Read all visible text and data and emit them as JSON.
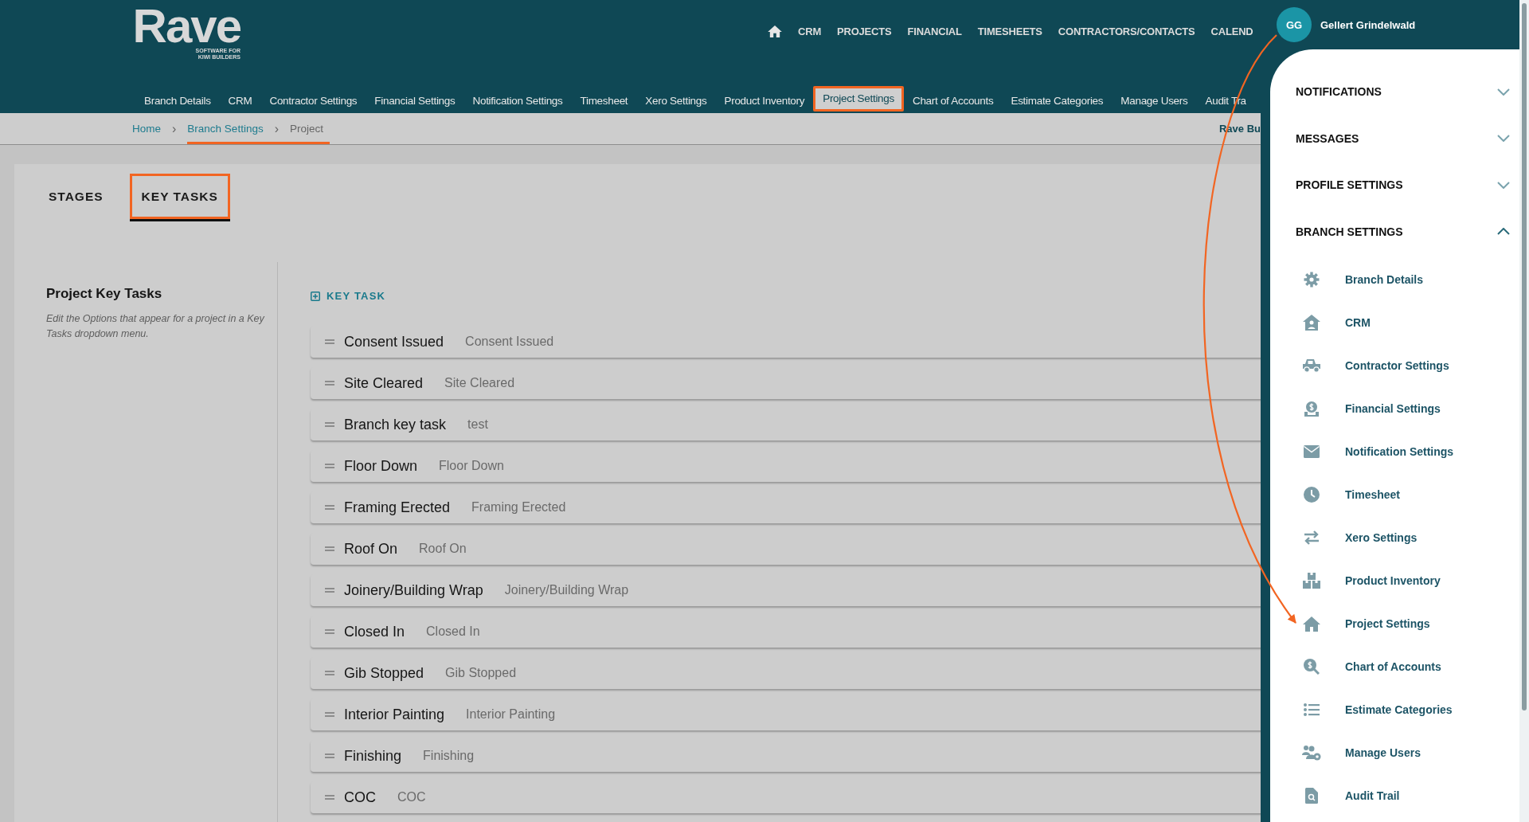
{
  "logo": {
    "name": "Rave",
    "tagline_1": "SOFTWARE FOR",
    "tagline_2": "KIWI BUILDERS"
  },
  "top_nav": [
    "CRM",
    "PROJECTS",
    "FINANCIAL",
    "TIMESHEETS",
    "CONTRACTORS/CONTACTS",
    "CALEND"
  ],
  "sub_nav": [
    {
      "label": "Branch Details",
      "selected": false,
      "highlighted": false
    },
    {
      "label": "CRM",
      "selected": false,
      "highlighted": false
    },
    {
      "label": "Contractor Settings",
      "selected": false,
      "highlighted": false
    },
    {
      "label": "Financial Settings",
      "selected": false,
      "highlighted": false
    },
    {
      "label": "Notification Settings",
      "selected": false,
      "highlighted": false
    },
    {
      "label": "Timesheet",
      "selected": false,
      "highlighted": false
    },
    {
      "label": "Xero Settings",
      "selected": false,
      "highlighted": false
    },
    {
      "label": "Product Inventory",
      "selected": false,
      "highlighted": false
    },
    {
      "label": "Project Settings",
      "selected": true,
      "highlighted": true
    },
    {
      "label": "Chart of Accounts",
      "selected": false,
      "highlighted": false
    },
    {
      "label": "Estimate Categories",
      "selected": false,
      "highlighted": false
    },
    {
      "label": "Manage Users",
      "selected": false,
      "highlighted": false
    },
    {
      "label": "Audit Tra",
      "selected": false,
      "highlighted": false
    }
  ],
  "breadcrumb": {
    "items": [
      {
        "label": "Home",
        "kind": "link",
        "underlined": false
      },
      {
        "label": "Branch Settings",
        "kind": "link",
        "underlined": true
      },
      {
        "label": "Project",
        "kind": "current",
        "underlined": true
      }
    ],
    "separator": "›",
    "company": "Rave Bu"
  },
  "tabs": [
    {
      "label": "STAGES",
      "selected": false,
      "highlighted": false
    },
    {
      "label": "KEY TASKS",
      "selected": true,
      "highlighted": true
    }
  ],
  "section": {
    "title": "Project Key Tasks",
    "description": "Edit the Options that appear for a project in a Key Tasks dropdown menu."
  },
  "add_button": "KEY TASK",
  "key_tasks": [
    {
      "name": "Consent Issued",
      "description": "Consent Issued"
    },
    {
      "name": "Site Cleared",
      "description": "Site Cleared"
    },
    {
      "name": "Branch key task",
      "description": "test"
    },
    {
      "name": "Floor Down",
      "description": "Floor Down"
    },
    {
      "name": "Framing Erected",
      "description": "Framing Erected"
    },
    {
      "name": "Roof On",
      "description": "Roof On"
    },
    {
      "name": "Joinery/Building Wrap",
      "description": "Joinery/Building Wrap"
    },
    {
      "name": "Closed In",
      "description": "Closed In"
    },
    {
      "name": "Gib Stopped",
      "description": "Gib Stopped"
    },
    {
      "name": "Interior Painting",
      "description": "Interior Painting"
    },
    {
      "name": "Finishing",
      "description": "Finishing"
    },
    {
      "name": "COC",
      "description": "COC"
    }
  ],
  "drawer": {
    "user": {
      "initials": "GG",
      "name": "Gellert Grindelwald"
    },
    "sections": [
      {
        "title": "NOTIFICATIONS",
        "expanded": false
      },
      {
        "title": "MESSAGES",
        "expanded": false
      },
      {
        "title": "PROFILE SETTINGS",
        "expanded": false
      },
      {
        "title": "BRANCH SETTINGS",
        "expanded": true
      }
    ],
    "branch_items": [
      "Branch Details",
      "CRM",
      "Contractor Settings",
      "Financial Settings",
      "Notification Settings",
      "Timesheet",
      "Xero Settings",
      "Product Inventory",
      "Project Settings",
      "Chart of Accounts",
      "Estimate Categories",
      "Manage Users",
      "Audit Trail"
    ]
  }
}
